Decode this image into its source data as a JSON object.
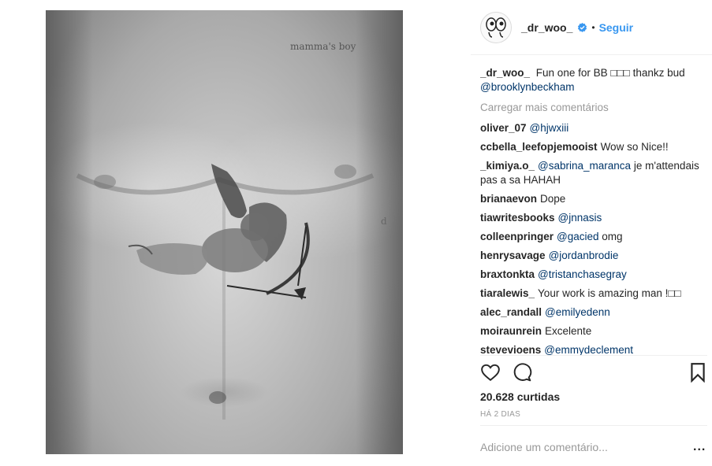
{
  "photo": {
    "alt_icon": "cupid-tattoo-photo",
    "chest_text": "mamma's boy",
    "side_text": "d"
  },
  "header": {
    "username": "_dr_woo_",
    "separator": "•",
    "follow_label": "Seguir",
    "verified_icon": "verified-badge-icon",
    "accent_color": "#3897f0"
  },
  "caption": {
    "username": "_dr_woo_",
    "text": "Fun one for BB □□□ thankz bud",
    "mention": "@brooklynbeckham"
  },
  "load_more": "Carregar mais comentários",
  "comments": [
    {
      "user": "oliver_07",
      "mention": "@hjwxiii",
      "text": ""
    },
    {
      "user": "ccbella_leefopjemooist",
      "mention": "",
      "text": "Wow so Nice!!"
    },
    {
      "user": "_kimiya.o_",
      "mention": "@sabrina_maranca",
      "text": "je m'attendais pas a sa HAHAH"
    },
    {
      "user": "brianaevon",
      "mention": "",
      "text": "Dope"
    },
    {
      "user": "tiawritesbooks",
      "mention": "@jnnasis",
      "text": ""
    },
    {
      "user": "colleenpringer",
      "mention": "@gacied",
      "text": "omg"
    },
    {
      "user": "henrysavage",
      "mention": "@jordanbrodie",
      "text": ""
    },
    {
      "user": "braxtonkta",
      "mention": "@tristanchasegray",
      "text": ""
    },
    {
      "user": "tiaralewis_",
      "mention": "",
      "text": "Your work is amazing man !□□"
    },
    {
      "user": "alec_randall",
      "mention": "@emilyedenn",
      "text": ""
    },
    {
      "user": "moiraunrein",
      "mention": "",
      "text": "Excelente"
    },
    {
      "user": "stevevioens",
      "mention": "@emmydeclement",
      "text": ""
    }
  ],
  "actions": {
    "like_icon": "heart-icon",
    "comment_icon": "comment-bubble-icon",
    "save_icon": "bookmark-icon"
  },
  "likes": "20.628 curtidas",
  "time": "HÁ 2 DIAS",
  "add_comment_placeholder": "Adicione um comentário...",
  "more_options": "..."
}
